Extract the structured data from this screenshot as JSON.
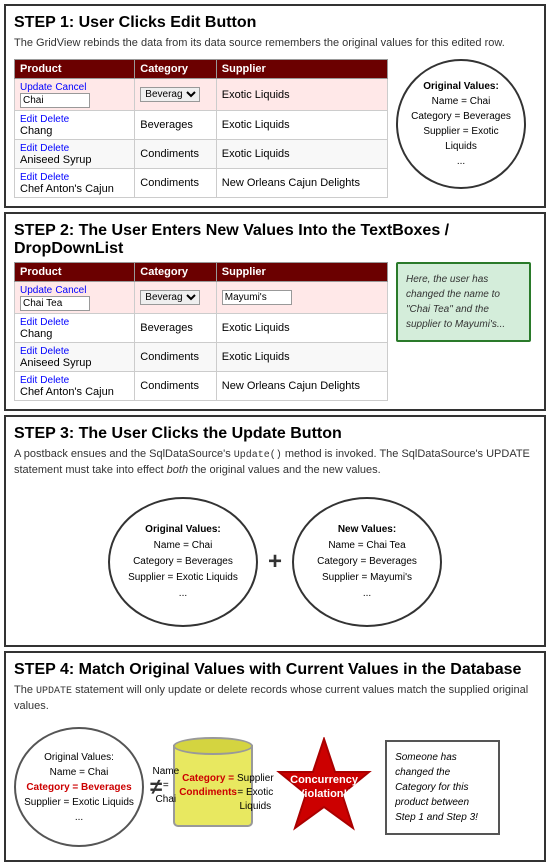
{
  "step1": {
    "title": "STEP 1: User Clicks Edit Button",
    "description": "The GridView rebinds the data from its data source remembers the original values for this edited row.",
    "table": {
      "headers": [
        "Product",
        "Category",
        "Supplier"
      ],
      "rows": [
        {
          "action": "Update Cancel",
          "product_input": true,
          "product": "Chai",
          "category_select": true,
          "category": "Beverages",
          "supplier": "Exotic Liquids",
          "edit_row": true
        },
        {
          "action": "Edit Delete",
          "product": "Chang",
          "category": "Beverages",
          "supplier": "Exotic Liquids",
          "edit_row": false
        },
        {
          "action": "Edit Delete",
          "product": "Aniseed Syrup",
          "category": "Condiments",
          "supplier": "Exotic Liquids",
          "edit_row": false
        },
        {
          "action": "Edit Delete",
          "product": "Chef Anton's Cajun",
          "category": "Condiments",
          "supplier": "New Orleans Cajun Delights",
          "edit_row": false
        }
      ]
    },
    "circle_note": {
      "lines": [
        "Original Values:",
        "Name = Chai",
        "Category = Beverages",
        "Supplier = Exotic Liquids",
        "..."
      ]
    }
  },
  "step2": {
    "title": "STEP 2: The User Enters New Values Into the TextBoxes / DropDownList",
    "table": {
      "headers": [
        "Product",
        "Category",
        "Supplier"
      ],
      "rows": [
        {
          "action": "Update Cancel",
          "product_input": true,
          "product": "Chai Tea",
          "category_select": true,
          "category": "Beverages",
          "supplier_input": true,
          "supplier": "Mayumi's",
          "edit_row": true
        },
        {
          "action": "Edit Delete",
          "product": "Chang",
          "category": "Beverages",
          "supplier": "Exotic Liquids",
          "edit_row": false
        },
        {
          "action": "Edit Delete",
          "product": "Aniseed Syrup",
          "category": "Condiments",
          "supplier": "Exotic Liquids",
          "edit_row": false
        },
        {
          "action": "Edit Delete",
          "product": "Chef Anton's Cajun",
          "category": "Condiments",
          "supplier": "New Orleans Cajun Delights",
          "edit_row": false
        }
      ]
    },
    "green_note": "Here, the user has changed the name to \"Chai Tea\" and the supplier to Mayumi's..."
  },
  "step3": {
    "title": "STEP 3: The User Clicks the Update Button",
    "description": "A postback ensues and the SqlDataSource's Update() method is invoked. The SqlDataSource's UPDATE statement must take into effect both the original values and the new values.",
    "original_circle": {
      "title": "Original Values:",
      "lines": [
        "Name = Chai",
        "Category = Beverages",
        "Supplier = Exotic Liquids",
        "..."
      ]
    },
    "plus": "+",
    "new_circle": {
      "title": "New Values:",
      "lines": [
        "Name = Chai Tea",
        "Category = Beverages",
        "Supplier = Mayumi's",
        "..."
      ]
    }
  },
  "step4": {
    "title": "STEP 4: Match Original Values with Current Values in the Database",
    "description": "The UPDATE statement will only update or delete records whose current values match the supplied original values.",
    "original_circle": {
      "lines": [
        "Original Values:",
        "Name = Chai",
        "Category = Beverages",
        "Supplier = Exotic Liquids",
        "..."
      ],
      "red_line": "Category = Beverages"
    },
    "neq": "≠",
    "cylinder": {
      "lines": [
        "Name = Chai",
        "Category = Condiments",
        "Supplier = Exotic Liquids"
      ],
      "red_line": "Category = Condiments"
    },
    "concurrency": {
      "label": "Concurrency\nViolation!!"
    },
    "italic_note": "Someone has changed the Category for this product between Step 1 and Step 3!"
  },
  "colors": {
    "header_bg": "#6b0000",
    "edit_row_bg": "#ffe8e8",
    "step_border": "#333",
    "green_note_border": "#2a7a2a",
    "green_note_bg": "#d4edda",
    "red": "#cc0000",
    "star_red": "#cc0000",
    "cylinder_bg": "#e8e860"
  }
}
